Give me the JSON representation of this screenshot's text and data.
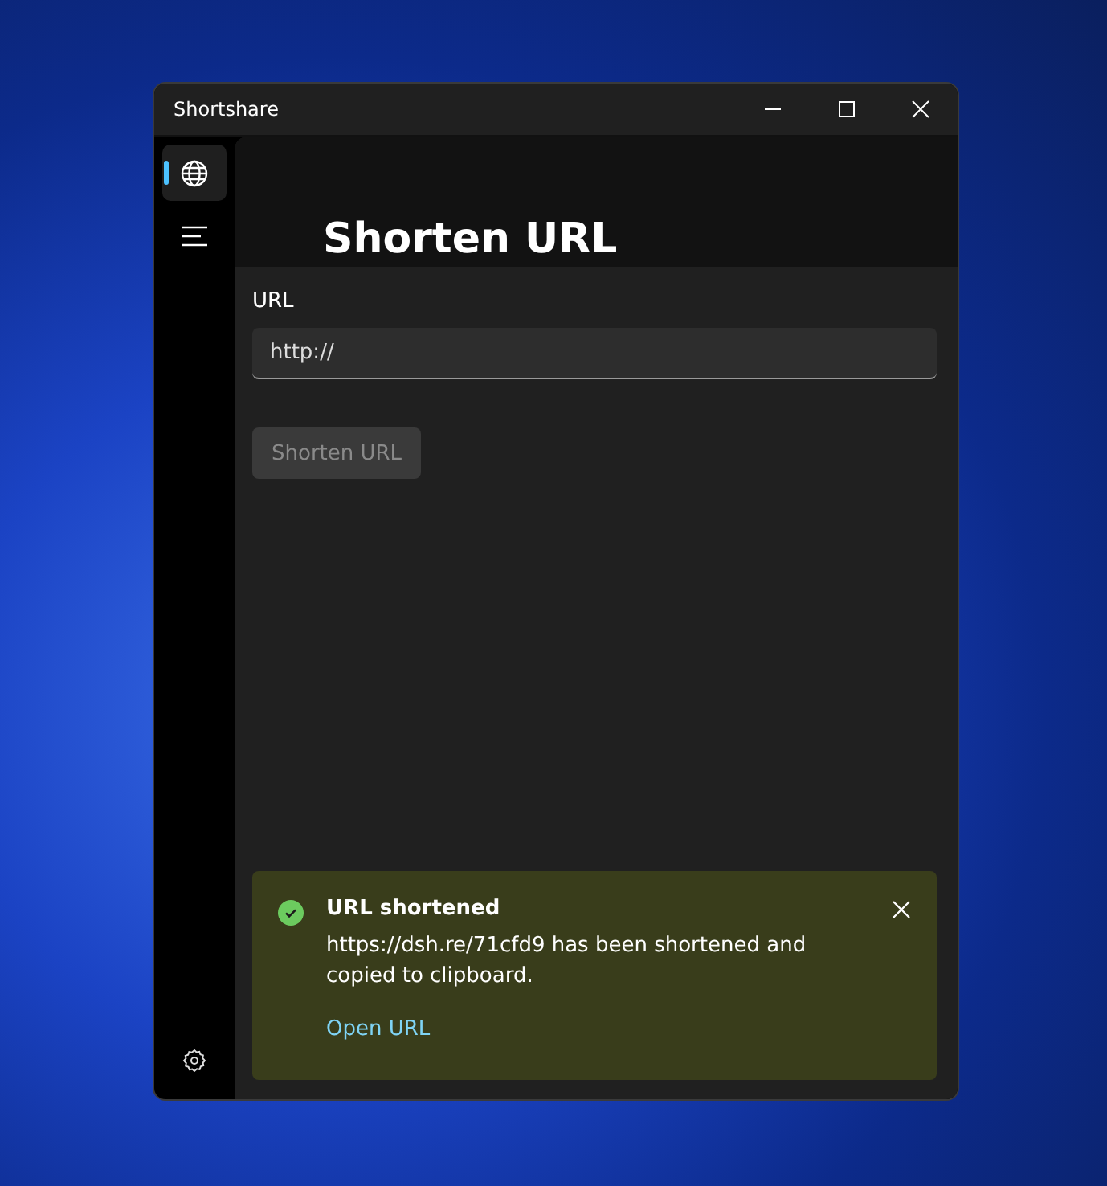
{
  "window": {
    "title": "Shortshare"
  },
  "nav": {
    "items": [
      {
        "kind": "globe",
        "selected": true
      },
      {
        "kind": "list",
        "selected": false
      }
    ]
  },
  "page": {
    "title": "Shorten URL"
  },
  "form": {
    "label": "URL",
    "value": "http://",
    "button": {
      "label": "Shorten URL",
      "disabled": true
    }
  },
  "toast": {
    "kind": "success",
    "title": "URL shortened",
    "message": "https://dsh.re/71cfd9 has been shortened and copied to clipboard.",
    "link": "Open URL"
  }
}
